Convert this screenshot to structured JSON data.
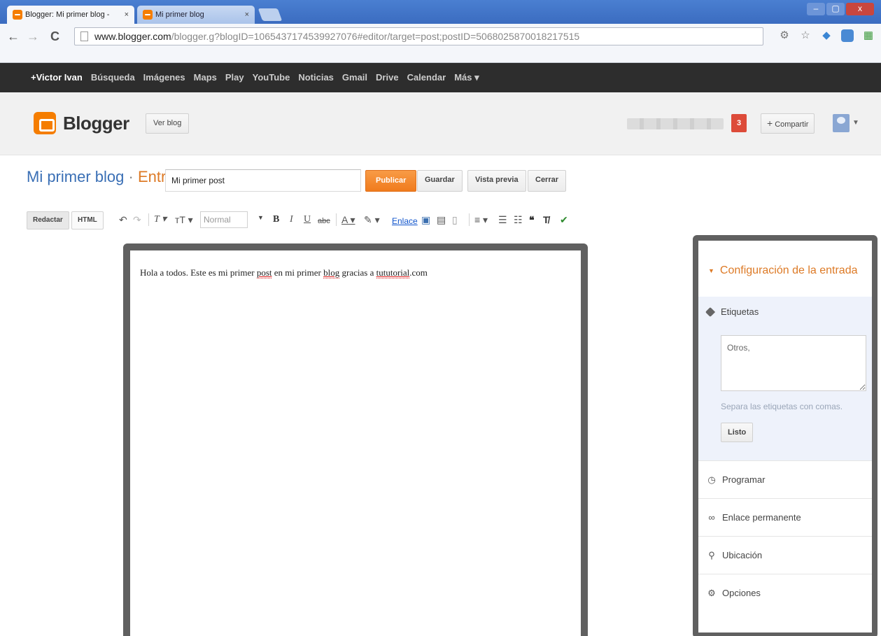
{
  "browser": {
    "tabs": [
      {
        "title": "Blogger: Mi primer blog -"
      },
      {
        "title": "Mi primer blog"
      }
    ],
    "tab_close": "×",
    "window_controls": {
      "minimize": "–",
      "maximize": "▢",
      "close": "x"
    },
    "url": {
      "host": "www.blogger.com",
      "path": "/blogger.g?blogID=1065437174539927076#editor/target=post;postID=5068025870018217515"
    }
  },
  "gbar": {
    "items": [
      "+Victor Ivan",
      "Búsqueda",
      "Imágenes",
      "Maps",
      "Play",
      "YouTube",
      "Noticias",
      "Gmail",
      "Drive",
      "Calendar",
      "Más ▾"
    ]
  },
  "header": {
    "logo_text": "Blogger",
    "view_blog": "Ver blog",
    "notifications": "3",
    "share": "Compartir",
    "share_plus": "+"
  },
  "title_row": {
    "blog_name": "Mi primer blog",
    "separator": " · ",
    "section": "Entrada",
    "post_title": "Mi primer post",
    "publish": "Publicar",
    "save": "Guardar",
    "preview": "Vista previa",
    "close": "Cerrar"
  },
  "editor_toolbar": {
    "compose": "Redactar",
    "html": "HTML",
    "format_value": "Normal",
    "link": "Enlace"
  },
  "editor": {
    "text_before_1": "Hola a todos. Este es mi primer ",
    "word_post": "post",
    "text_before_2": " en mi primer ",
    "word_blog": "blog",
    "text_before_3": " gracias a ",
    "word_tutorial": "tututorial",
    "text_after": ".com"
  },
  "sidebar": {
    "heading": "Configuración de la entrada",
    "labels_title": "Etiquetas",
    "labels_value": "Otros,",
    "labels_hint": "Separa las etiquetas con comas.",
    "done": "Listo",
    "items": [
      "Programar",
      "Enlace permanente",
      "Ubicación",
      "Opciones"
    ]
  },
  "colors": {
    "accent_orange": "#f57d00",
    "link_blue": "#3a6fb5",
    "gbar_bg": "#2d2d2d",
    "frame_gray": "#606060"
  }
}
